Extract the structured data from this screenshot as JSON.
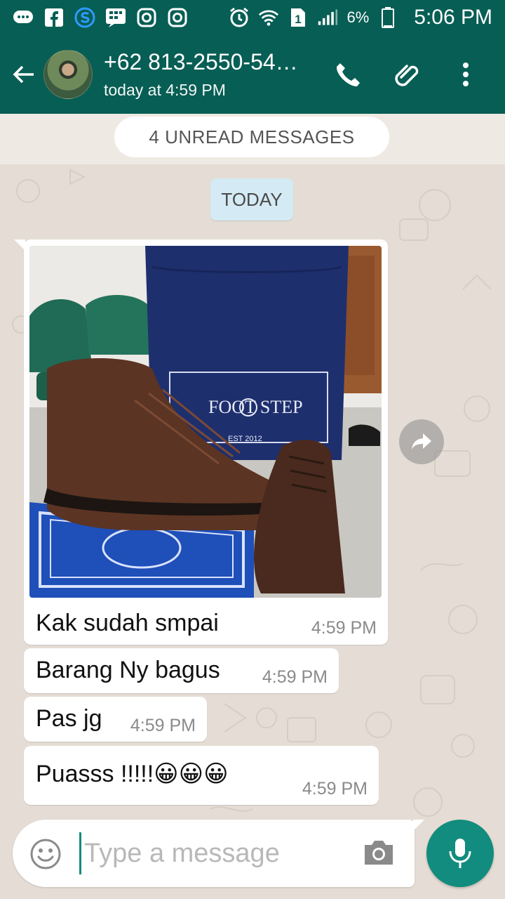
{
  "status_bar": {
    "battery": "6%",
    "time": "5:06 PM",
    "icons": [
      "chat-icon",
      "facebook-icon",
      "s-icon",
      "bbm-icon",
      "instagram-icon",
      "instagram-icon",
      "alarm-icon",
      "wifi-icon",
      "sim-1-icon",
      "signal-icon",
      "battery-icon"
    ]
  },
  "header": {
    "contact_name": "+62 813-2550-54…",
    "last_seen": "today at 4:59 PM"
  },
  "chat": {
    "unread_banner": "4 UNREAD MESSAGES",
    "date_label": "TODAY",
    "image_caption_brand": "FOOT STEP",
    "image_caption_est": "EST 2012",
    "messages": [
      {
        "text": "Kak sudah smpai",
        "time": "4:59 PM"
      },
      {
        "text": "Barang Ny bagus",
        "time": "4:59 PM"
      },
      {
        "text": "Pas jg",
        "time": "4:59 PM"
      },
      {
        "text": "Puasss !!!!!😀😀😀",
        "time": "4:59 PM"
      }
    ]
  },
  "input": {
    "placeholder": "Type a message",
    "value": ""
  },
  "colors": {
    "header": "#075e54",
    "accent": "#128c7e",
    "chat_bg": "#e5ddd5",
    "date_pill": "#d4eaf4"
  }
}
